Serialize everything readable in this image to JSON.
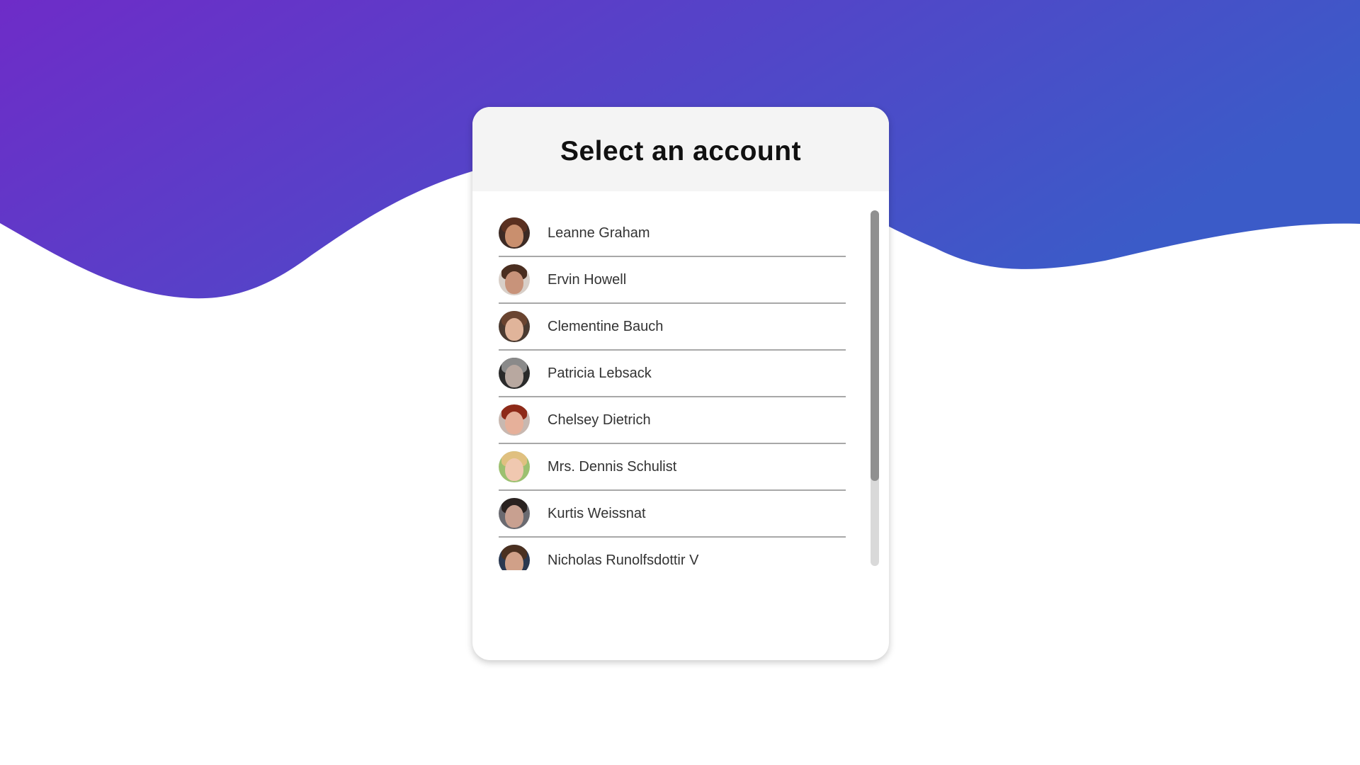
{
  "page": {
    "gradient_start": "#6e2cc8",
    "gradient_end": "#3b5bc8"
  },
  "card": {
    "title": "Select an account"
  },
  "accounts": [
    {
      "name": "Leanne Graham",
      "skin": "#c98f6e",
      "hair": "#5a3020",
      "bg": "#3c2a24"
    },
    {
      "name": "Ervin Howell",
      "skin": "#c8937a",
      "hair": "#4a2e20",
      "bg": "#d8cfc8"
    },
    {
      "name": "Clementine Bauch",
      "skin": "#e0b49a",
      "hair": "#6a4430",
      "bg": "#4a3a30"
    },
    {
      "name": "Patricia Lebsack",
      "skin": "#b8a8a0",
      "hair": "#8a8a8a",
      "bg": "#2a2a2a"
    },
    {
      "name": "Chelsey Dietrich",
      "skin": "#e6b09a",
      "hair": "#8e2a18",
      "bg": "#c8b8b0"
    },
    {
      "name": "Mrs. Dennis Schulist",
      "skin": "#f0c8b0",
      "hair": "#e0c080",
      "bg": "#9cc070"
    },
    {
      "name": "Kurtis Weissnat",
      "skin": "#c8a090",
      "hair": "#2a2220",
      "bg": "#6a6a70"
    },
    {
      "name": "Nicholas Runolfsdottir V",
      "skin": "#d0a088",
      "hair": "#4a3020",
      "bg": "#2a3850"
    }
  ],
  "scrollbar": {
    "position_fraction": 0.0,
    "visible_fraction": 0.76
  }
}
